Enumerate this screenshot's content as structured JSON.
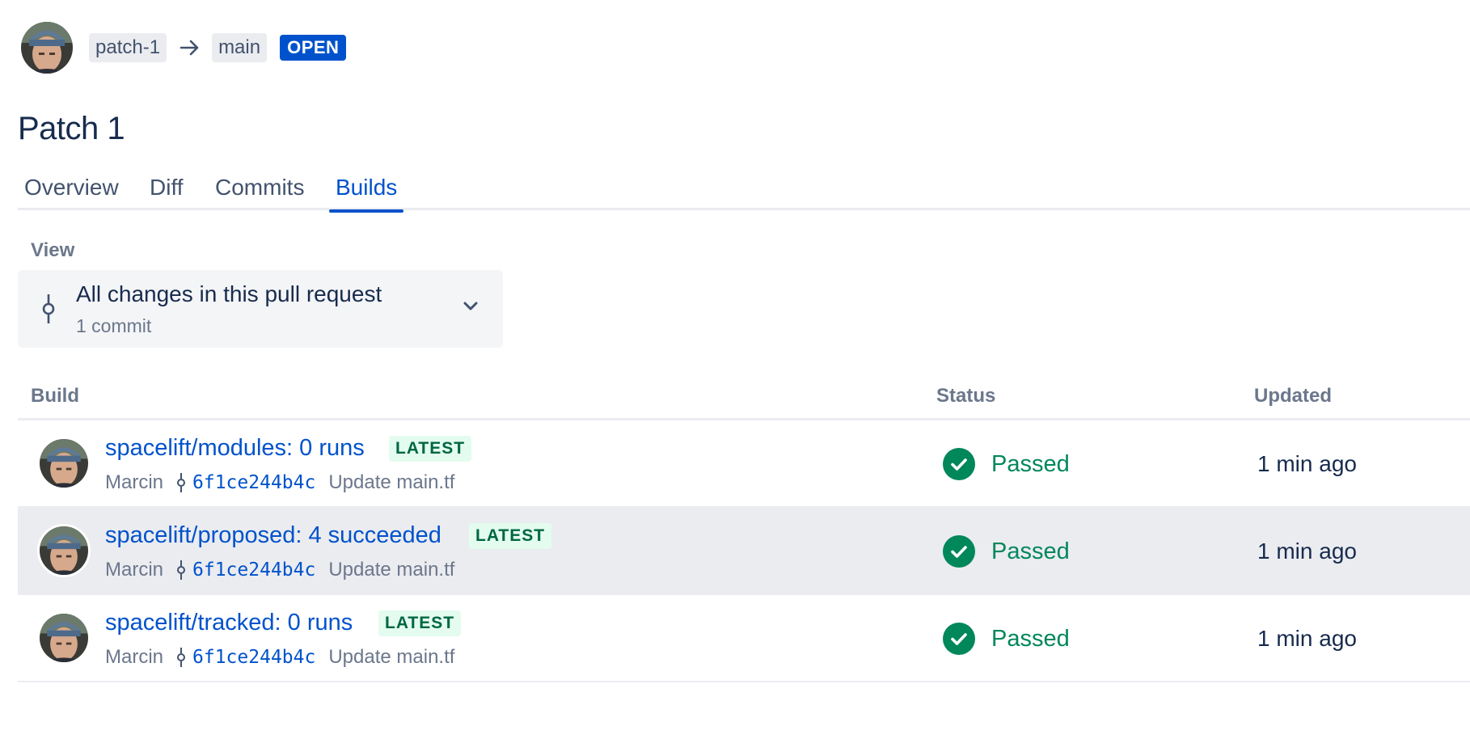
{
  "header": {
    "source_branch": "patch-1",
    "target_branch": "main",
    "state": "OPEN"
  },
  "title": "Patch 1",
  "tabs": [
    {
      "label": "Overview",
      "active": false
    },
    {
      "label": "Diff",
      "active": false
    },
    {
      "label": "Commits",
      "active": false
    },
    {
      "label": "Builds",
      "active": true
    }
  ],
  "view": {
    "label": "View",
    "selected": "All changes in this pull request",
    "subtitle": "1 commit"
  },
  "table": {
    "columns": [
      "Build",
      "Status",
      "Updated"
    ],
    "rows": [
      {
        "name": "spacelift/modules: 0 runs",
        "badge": "LATEST",
        "author": "Marcin",
        "hash": "6f1ce244b4c",
        "message": "Update main.tf",
        "status": "Passed",
        "updated": "1 min ago",
        "highlighted": false
      },
      {
        "name": "spacelift/proposed: 4 succeeded",
        "badge": "LATEST",
        "author": "Marcin",
        "hash": "6f1ce244b4c",
        "message": "Update main.tf",
        "status": "Passed",
        "updated": "1 min ago",
        "highlighted": true
      },
      {
        "name": "spacelift/tracked: 0 runs",
        "badge": "LATEST",
        "author": "Marcin",
        "hash": "6f1ce244b4c",
        "message": "Update main.tf",
        "status": "Passed",
        "updated": "1 min ago",
        "highlighted": false
      }
    ]
  },
  "icons": {
    "branch_arrow": "arrow-right-icon",
    "view_select": "commit-icon",
    "dropdown": "chevron-down-icon",
    "status": "check-circle-icon"
  },
  "colors": {
    "primary": "#0052cc",
    "success": "#00875a",
    "latest_bg": "#e3fcef",
    "latest_text": "#006644",
    "highlight_row": "#ebecf0"
  }
}
